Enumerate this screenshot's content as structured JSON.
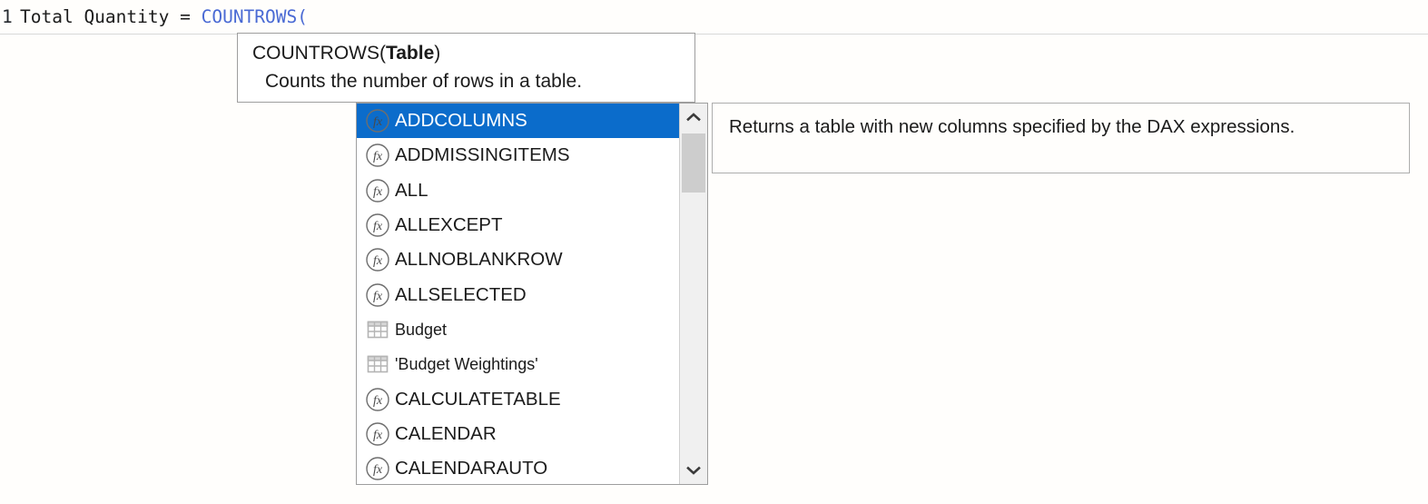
{
  "formula_bar": {
    "line_number": "1",
    "measure_name": "Total Quantity ",
    "assignment": "= ",
    "function_token": "COUNTROWS("
  },
  "signature_tooltip": {
    "function_name": "COUNTROWS(",
    "argument": "Table",
    "closing_paren": ")",
    "description": "Counts the number of rows in a table."
  },
  "completion_list": {
    "selected_index": 0,
    "selection_color": "#0b6ccb",
    "items": [
      {
        "label": "ADDCOLUMNS",
        "icon": "function-fx-icon",
        "kind": "function"
      },
      {
        "label": "ADDMISSINGITEMS",
        "icon": "function-fx-icon",
        "kind": "function"
      },
      {
        "label": "ALL",
        "icon": "function-fx-icon",
        "kind": "function"
      },
      {
        "label": "ALLEXCEPT",
        "icon": "function-fx-icon",
        "kind": "function"
      },
      {
        "label": "ALLNOBLANKROW",
        "icon": "function-fx-icon",
        "kind": "function"
      },
      {
        "label": "ALLSELECTED",
        "icon": "function-fx-icon",
        "kind": "function"
      },
      {
        "label": "Budget",
        "icon": "table-grid-icon",
        "kind": "table"
      },
      {
        "label": "'Budget Weightings'",
        "icon": "table-grid-icon",
        "kind": "table"
      },
      {
        "label": "CALCULATETABLE",
        "icon": "function-fx-icon",
        "kind": "function"
      },
      {
        "label": "CALENDAR",
        "icon": "function-fx-icon",
        "kind": "function"
      },
      {
        "label": "CALENDARAUTO",
        "icon": "function-fx-icon",
        "kind": "function"
      }
    ],
    "scrollbar": {
      "up_arrow_icon": "chevron-up-icon",
      "down_arrow_icon": "chevron-down-icon"
    }
  },
  "description_panel": {
    "text": "Returns a table with new columns specified by the DAX expressions."
  }
}
